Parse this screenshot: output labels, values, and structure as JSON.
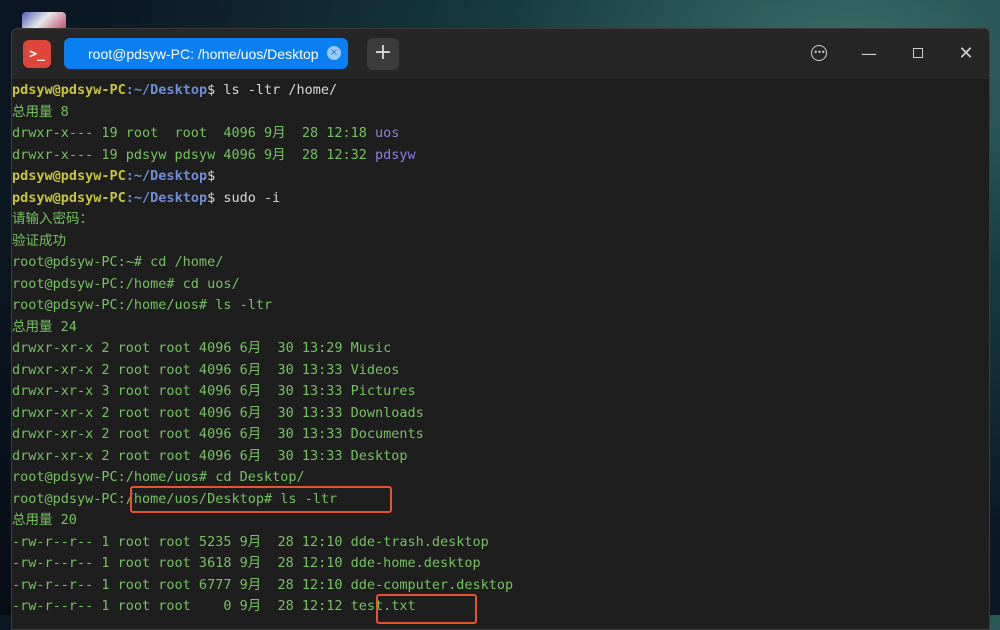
{
  "window": {
    "tab_title": "root@pdsyw-PC: /home/uos/Desktop",
    "tab_close_glyph": "×",
    "add_tab_glyph": "+",
    "menu_glyph": "•••",
    "minimize_glyph": "—",
    "close_glyph": "✕",
    "app_icon_glyph": ">_"
  },
  "terminal": {
    "lines": [
      {
        "segments": [
          {
            "t": "pdsyw@pdsyw-PC",
            "c": "prompt"
          },
          {
            "t": ":~/Desktop",
            "c": "path"
          },
          {
            "t": "$ ls -ltr /home/",
            "c": "cmd"
          }
        ]
      },
      {
        "segments": [
          {
            "t": "总用量 8",
            "c": "out"
          }
        ]
      },
      {
        "segments": [
          {
            "t": "drwxr-x--- 19 root  root  4096 9月  28 12:18 ",
            "c": "out"
          },
          {
            "t": "uos",
            "c": "dir"
          }
        ]
      },
      {
        "segments": [
          {
            "t": "drwxr-x--- 19 pdsyw pdsyw 4096 9月  28 12:32 ",
            "c": "out"
          },
          {
            "t": "pdsyw",
            "c": "dir"
          }
        ]
      },
      {
        "segments": [
          {
            "t": "pdsyw@pdsyw-PC",
            "c": "prompt"
          },
          {
            "t": ":~/Desktop",
            "c": "path"
          },
          {
            "t": "$",
            "c": "cmd"
          }
        ]
      },
      {
        "segments": [
          {
            "t": "pdsyw@pdsyw-PC",
            "c": "prompt"
          },
          {
            "t": ":~/Desktop",
            "c": "path"
          },
          {
            "t": "$ sudo -i",
            "c": "cmd"
          }
        ]
      },
      {
        "segments": [
          {
            "t": "请输入密码：",
            "c": "out"
          }
        ]
      },
      {
        "segments": [
          {
            "t": "验证成功",
            "c": "out"
          }
        ]
      },
      {
        "segments": [
          {
            "t": "root@pdsyw-PC:~# cd /home/",
            "c": "out"
          }
        ]
      },
      {
        "segments": [
          {
            "t": "root@pdsyw-PC:/home# cd uos/",
            "c": "out"
          }
        ]
      },
      {
        "segments": [
          {
            "t": "root@pdsyw-PC:/home/uos# ls -ltr",
            "c": "out"
          }
        ]
      },
      {
        "segments": [
          {
            "t": "总用量 24",
            "c": "out"
          }
        ]
      },
      {
        "segments": [
          {
            "t": "drwxr-xr-x 2 root root 4096 6月  30 13:29 Music",
            "c": "out"
          }
        ]
      },
      {
        "segments": [
          {
            "t": "drwxr-xr-x 2 root root 4096 6月  30 13:33 Videos",
            "c": "out"
          }
        ]
      },
      {
        "segments": [
          {
            "t": "drwxr-xr-x 3 root root 4096 6月  30 13:33 Pictures",
            "c": "out"
          }
        ]
      },
      {
        "segments": [
          {
            "t": "drwxr-xr-x 2 root root 4096 6月  30 13:33 Downloads",
            "c": "out"
          }
        ]
      },
      {
        "segments": [
          {
            "t": "drwxr-xr-x 2 root root 4096 6月  30 13:33 Documents",
            "c": "out"
          }
        ]
      },
      {
        "segments": [
          {
            "t": "drwxr-xr-x 2 root root 4096 6月  30 13:33 Desktop",
            "c": "out"
          }
        ]
      },
      {
        "segments": [
          {
            "t": "root@pdsyw-PC:/home/uos# cd Desktop/",
            "c": "out"
          }
        ]
      },
      {
        "segments": [
          {
            "t": "root@pdsyw-PC:/home/uos/Desktop# ls -ltr",
            "c": "out"
          }
        ]
      },
      {
        "segments": [
          {
            "t": "总用量 20",
            "c": "out"
          }
        ]
      },
      {
        "segments": [
          {
            "t": "-rw-r--r-- 1 root root 5235 9月  28 12:10 dde-trash.desktop",
            "c": "out"
          }
        ]
      },
      {
        "segments": [
          {
            "t": "-rw-r--r-- 1 root root 3618 9月  28 12:10 dde-home.desktop",
            "c": "out"
          }
        ]
      },
      {
        "segments": [
          {
            "t": "-rw-r--r-- 1 root root 6777 9月  28 12:10 dde-computer.desktop",
            "c": "out"
          }
        ]
      },
      {
        "segments": [
          {
            "t": "-rw-r--r-- 1 root root    0 9月  28 12:12 test.txt",
            "c": "out"
          }
        ]
      }
    ]
  },
  "colors": {
    "tab_accent": "#0a7ff2",
    "prompt_user": "#c8c440",
    "prompt_path": "#6f8dd6",
    "output_text": "#74c25f",
    "directory": "#8c7fe0",
    "highlight_box": "#e4572e"
  }
}
